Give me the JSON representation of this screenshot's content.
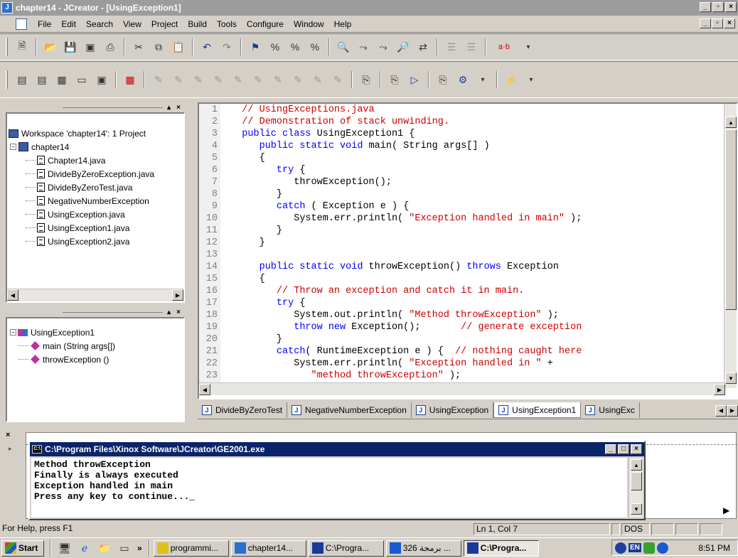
{
  "window": {
    "title": "chapter14 - JCreator - [UsingException1]"
  },
  "menu": [
    "File",
    "Edit",
    "Search",
    "View",
    "Project",
    "Build",
    "Tools",
    "Configure",
    "Window",
    "Help"
  ],
  "toolbar": {
    "find_replace_label": "a·b"
  },
  "workspace": {
    "root": "Workspace 'chapter14': 1 Project",
    "project": "chapter14",
    "files": [
      "Chapter14.java",
      "DivideByZeroException.java",
      "DivideByZeroTest.java",
      "NegativeNumberException",
      "UsingException.java",
      "UsingException1.java",
      "UsingException2.java"
    ]
  },
  "class_view": {
    "class_name": "UsingException1",
    "members": [
      "main (String args[])",
      "throwException ()"
    ]
  },
  "editor": {
    "line_numbers": [
      "1",
      "2",
      "3",
      "4",
      "5",
      "6",
      "7",
      "8",
      "9",
      "10",
      "11",
      "12",
      "13",
      "14",
      "15",
      "16",
      "17",
      "18",
      "19",
      "20",
      "21",
      "22",
      "23"
    ],
    "lines": [
      [
        [
          "cm",
          "   // UsingExceptions.java"
        ]
      ],
      [
        [
          "cm",
          "   // Demonstration of stack unwinding."
        ]
      ],
      [
        [
          "kw",
          "   public class "
        ],
        [
          "tx",
          "UsingException1 {"
        ]
      ],
      [
        [
          "kw",
          "      public static void "
        ],
        [
          "tx",
          "main( String args[] )"
        ]
      ],
      [
        [
          "tx",
          "      {"
        ]
      ],
      [
        [
          "kw",
          "         try "
        ],
        [
          "tx",
          "{"
        ]
      ],
      [
        [
          "tx",
          "            throwException();"
        ]
      ],
      [
        [
          "tx",
          "         }"
        ]
      ],
      [
        [
          "kw",
          "         catch "
        ],
        [
          "tx",
          "( Exception e ) {"
        ]
      ],
      [
        [
          "tx",
          "            System.err.println( "
        ],
        [
          "str",
          "\"Exception handled in main\""
        ],
        [
          "tx",
          " );"
        ]
      ],
      [
        [
          "tx",
          "         }"
        ]
      ],
      [
        [
          "tx",
          "      }"
        ]
      ],
      [
        [
          "tx",
          ""
        ]
      ],
      [
        [
          "kw",
          "      public static void "
        ],
        [
          "tx",
          "throwException() "
        ],
        [
          "kw",
          "throws "
        ],
        [
          "tx",
          "Exception"
        ]
      ],
      [
        [
          "tx",
          "      {"
        ]
      ],
      [
        [
          "cm",
          "         // Throw an exception and catch it in main."
        ]
      ],
      [
        [
          "kw",
          "         try "
        ],
        [
          "tx",
          "{"
        ]
      ],
      [
        [
          "tx",
          "            System.out.println( "
        ],
        [
          "str",
          "\"Method throwException\""
        ],
        [
          "tx",
          " );"
        ]
      ],
      [
        [
          "kw",
          "            throw new "
        ],
        [
          "tx",
          "Exception();       "
        ],
        [
          "cm",
          "// generate exception"
        ]
      ],
      [
        [
          "tx",
          "         }"
        ]
      ],
      [
        [
          "kw",
          "         catch"
        ],
        [
          "tx",
          "( RuntimeException e ) {  "
        ],
        [
          "cm",
          "// nothing caught here"
        ]
      ],
      [
        [
          "tx",
          "            System.err.println( "
        ],
        [
          "str",
          "\"Exception handled in \""
        ],
        [
          "tx",
          " +"
        ]
      ],
      [
        [
          "str",
          "               \"method throwException\""
        ],
        [
          "tx",
          " );"
        ]
      ]
    ]
  },
  "doc_tabs": [
    "DivideByZeroTest",
    "NegativeNumberException",
    "UsingException",
    "UsingException1",
    "UsingExc"
  ],
  "active_tab": "UsingException1",
  "console": {
    "title": "C:\\Program Files\\Xinox Software\\JCreator\\GE2001.exe",
    "lines": [
      "Method throwException",
      "Finally is always executed",
      "Exception handled in main",
      "Press any key to continue..._"
    ]
  },
  "status": {
    "help": "For Help, press F1",
    "position": "Ln 1, Col 7",
    "mode": "DOS"
  },
  "taskbar": {
    "start": "Start",
    "chevron": "»",
    "tasks": [
      "programmi...",
      "chapter14...",
      "C:\\Progra...",
      "326 برمجة ...",
      "C:\\Progra..."
    ],
    "lang": "EN",
    "time": "8:51 PM"
  }
}
